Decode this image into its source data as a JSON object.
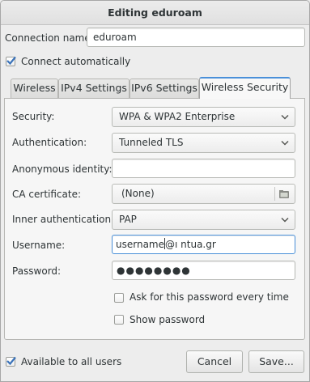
{
  "window": {
    "title": "Editing eduroam"
  },
  "connection": {
    "name_label": "Connection name:",
    "name_value": "eduroam",
    "auto_connect_label": "Connect automatically",
    "auto_connect_checked": true
  },
  "tabs": [
    {
      "label": "Wireless",
      "active": false
    },
    {
      "label": "IPv4 Settings",
      "active": false
    },
    {
      "label": "IPv6 Settings",
      "active": false
    },
    {
      "label": "Wireless Security",
      "active": true
    }
  ],
  "security": {
    "security_label": "Security:",
    "security_value": "WPA & WPA2 Enterprise",
    "auth_label": "Authentication:",
    "auth_value": "Tunneled TLS",
    "anon_label": "Anonymous identity:",
    "anon_value": "",
    "ca_label": "CA certificate:",
    "ca_value": "(None)",
    "inner_label": "Inner authentication:",
    "inner_value": "PAP",
    "username_label": "Username:",
    "username_before_caret": "username",
    "username_after_caret": "@ı ntua.gr",
    "password_label": "Password:",
    "password_mask": "●●●●●●●●",
    "ask_password_label": "Ask for this password every time",
    "ask_password_checked": false,
    "show_password_label": "Show password",
    "show_password_checked": false
  },
  "footer": {
    "all_users_label": "Available to all users",
    "all_users_checked": true,
    "cancel_label": "Cancel",
    "save_label": "Save..."
  },
  "colors": {
    "accent": "#4a90d9",
    "check": "#3b73b9"
  },
  "icons": {
    "combo_arrow": "chevron-down-icon",
    "file_chooser": "folder-icon",
    "checkmark": "checkmark-icon"
  }
}
